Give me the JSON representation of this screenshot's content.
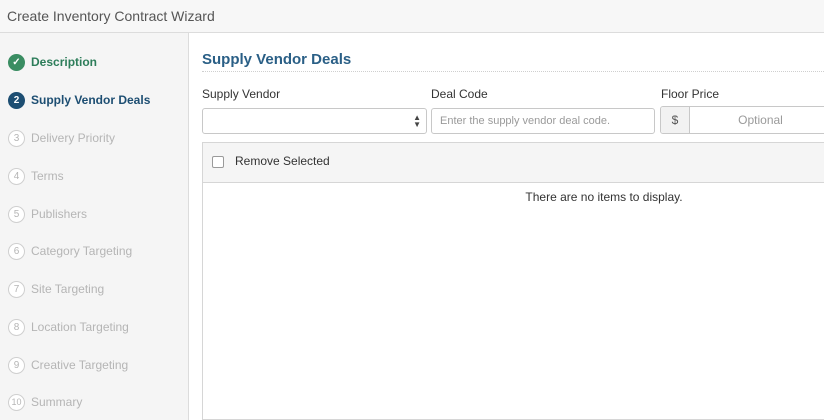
{
  "window": {
    "title": "Create Inventory Contract Wizard"
  },
  "steps": [
    {
      "num": "✓",
      "label": "Description",
      "state": "done",
      "icon": "check-icon"
    },
    {
      "num": "2",
      "label": "Supply Vendor Deals",
      "state": "active"
    },
    {
      "num": "3",
      "label": "Delivery Priority",
      "state": "pending"
    },
    {
      "num": "4",
      "label": "Terms",
      "state": "pending"
    },
    {
      "num": "5",
      "label": "Publishers",
      "state": "pending"
    },
    {
      "num": "6",
      "label": "Category Targeting",
      "state": "pending"
    },
    {
      "num": "7",
      "label": "Site Targeting",
      "state": "pending"
    },
    {
      "num": "8",
      "label": "Location Targeting",
      "state": "pending"
    },
    {
      "num": "9",
      "label": "Creative Targeting",
      "state": "pending"
    },
    {
      "num": "10",
      "label": "Summary",
      "state": "pending"
    }
  ],
  "main": {
    "section_title": "Supply Vendor Deals",
    "form": {
      "vendor_label": "Supply Vendor",
      "vendor_value": "",
      "deal_label": "Deal Code",
      "deal_placeholder": "Enter the supply vendor deal code.",
      "price_label": "Floor Price",
      "currency": "$",
      "price_placeholder": "Optional"
    },
    "grid": {
      "remove_label": "Remove Selected",
      "empty_text": "There are no items to display."
    }
  },
  "colors": {
    "done": "#3a8d62",
    "active": "#1d4e72",
    "heading": "#2a5f86"
  }
}
